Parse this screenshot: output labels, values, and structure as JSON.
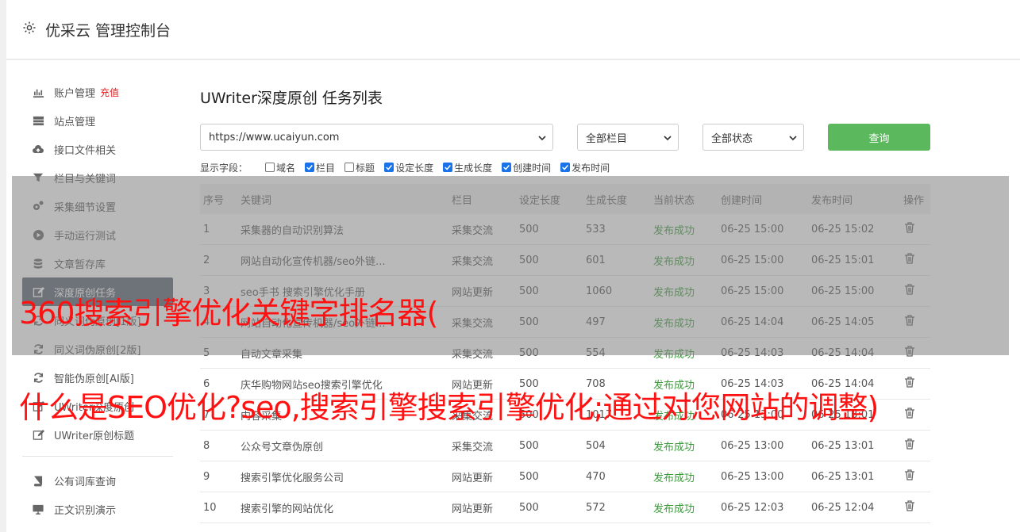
{
  "app": {
    "title": "优采云 管理控制台"
  },
  "sidebar": {
    "items": [
      {
        "label": "账户管理",
        "extra": "充值",
        "icon": "bar-chart-icon"
      },
      {
        "label": "站点管理",
        "icon": "server-icon"
      },
      {
        "label": "接口文件相关",
        "icon": "cloud-upload-icon"
      },
      {
        "label": "栏目与关键词",
        "icon": "filter-icon"
      },
      {
        "label": "采集细节设置",
        "icon": "gears-icon"
      },
      {
        "label": "手动运行测试",
        "icon": "play-circle-icon"
      },
      {
        "label": "文章暂存库",
        "icon": "database-icon"
      },
      {
        "label": "深度原创任务",
        "icon": "edit-icon",
        "active": true
      },
      {
        "label": "同义词伪原创[1版]",
        "icon": "refresh-icon"
      },
      {
        "label": "同义词伪原创[2版]",
        "icon": "refresh-icon"
      },
      {
        "label": "智能伪原创[AI版]",
        "icon": "refresh-icon"
      },
      {
        "label": "UWriter深度原创",
        "icon": "edit-icon"
      },
      {
        "label": "UWriter原创标题",
        "icon": "edit-icon"
      },
      {
        "label": "公有词库查询",
        "icon": "book-icon"
      },
      {
        "label": "正文识别演示",
        "icon": "monitor-icon"
      }
    ]
  },
  "main": {
    "title": "UWriter深度原创 任务列表",
    "filters": {
      "site": "https://www.ucaiyun.com",
      "column": "全部栏目",
      "status": "全部状态",
      "query_label": "查询"
    },
    "fields": {
      "label": "显示字段：",
      "options": [
        {
          "label": "域名",
          "checked": false
        },
        {
          "label": "栏目",
          "checked": true
        },
        {
          "label": "标题",
          "checked": false
        },
        {
          "label": "设定长度",
          "checked": true
        },
        {
          "label": "生成长度",
          "checked": true
        },
        {
          "label": "创建时间",
          "checked": true
        },
        {
          "label": "发布时间",
          "checked": true
        }
      ]
    },
    "table": {
      "headers": [
        "序号",
        "关键词",
        "栏目",
        "设定长度",
        "生成长度",
        "当前状态",
        "创建时间",
        "发布时间",
        "操作"
      ],
      "rows": [
        [
          "1",
          "采集器的自动识别算法",
          "采集交流",
          "500",
          "533",
          "发布成功",
          "06-25 15:00",
          "06-25 15:02"
        ],
        [
          "2",
          "网站自动化宣传机器/seo外链...",
          "采集交流",
          "500",
          "601",
          "发布成功",
          "06-25 15:00",
          "06-25 15:01"
        ],
        [
          "3",
          "seo手书 搜索引擎优化手册",
          "网站更新",
          "500",
          "1060",
          "发布成功",
          "06-25 15:00",
          "06-25 15:00"
        ],
        [
          "4",
          "网站自动化宣传机器/seo外链...",
          "采集交流",
          "500",
          "497",
          "发布成功",
          "06-25 14:04",
          "06-25 14:05"
        ],
        [
          "5",
          "自动文章采集",
          "采集交流",
          "500",
          "554",
          "发布成功",
          "06-25 14:03",
          "06-25 14:04"
        ],
        [
          "6",
          "庆华购物网站seo搜索引擎优化",
          "网站更新",
          "500",
          "708",
          "发布成功",
          "06-25 14:03",
          "06-25 14:04"
        ],
        [
          "7",
          "内容采集",
          "采集交流",
          "500",
          "1017",
          "发布成功",
          "06-25 13:00",
          "06-25 13:01"
        ],
        [
          "8",
          "公众号文章伪原创",
          "采集交流",
          "500",
          "504",
          "发布成功",
          "06-25 13:00",
          "06-25 13:01"
        ],
        [
          "9",
          "搜索引擎优化服务公司",
          "网站更新",
          "500",
          "470",
          "发布成功",
          "06-25 13:00",
          "06-25 13:01"
        ],
        [
          "10",
          "搜索引擎的网站优化",
          "网站更新",
          "500",
          "572",
          "发布成功",
          "06-25 12:03",
          "06-25 12:04"
        ]
      ]
    }
  },
  "overlay": {
    "line1": "360搜索引擎优化关键字排名器(",
    "line2": "什么是SEO优化?seo,搜索引擎搜索引擎优化;通过对您网站的调整)"
  },
  "colors": {
    "accent": "#5cb85c",
    "active_nav": "#5a6573",
    "success": "#3a9a3a",
    "caption": "#ff1111"
  }
}
